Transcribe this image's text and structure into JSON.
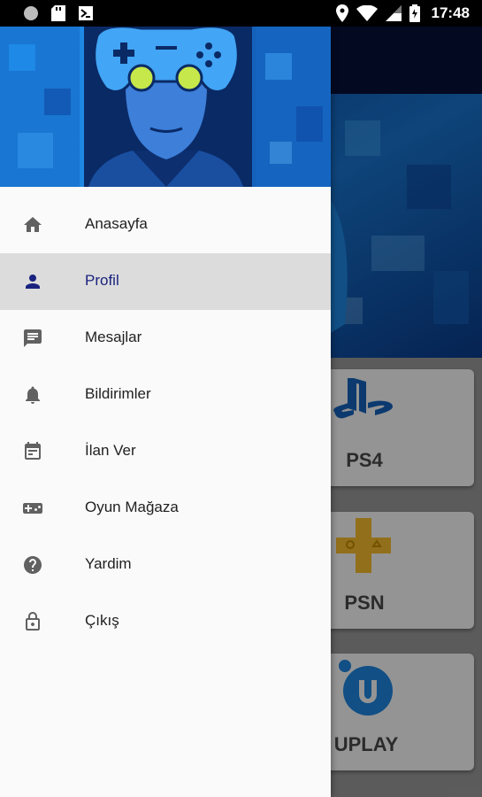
{
  "status_bar": {
    "time": "17:48",
    "icons": [
      "record-icon",
      "sd-card-icon",
      "app-notification-icon",
      "location-icon",
      "wifi-icon",
      "cell-signal-icon",
      "battery-icon"
    ]
  },
  "drawer": {
    "header_image": "gamer-controller-illustration",
    "items": [
      {
        "label": "Anasayfa",
        "icon": "home-icon",
        "active": false
      },
      {
        "label": "Profil",
        "icon": "person-icon",
        "active": true
      },
      {
        "label": "Mesajlar",
        "icon": "message-icon",
        "active": false
      },
      {
        "label": "Bildirimler",
        "icon": "bell-icon",
        "active": false
      },
      {
        "label": "İlan Ver",
        "icon": "calendar-icon",
        "active": false
      },
      {
        "label": "Oyun Mağaza",
        "icon": "gamepad-icon",
        "active": false
      },
      {
        "label": "Yardim",
        "icon": "help-icon",
        "active": false
      },
      {
        "label": "Çıkış",
        "icon": "lock-icon",
        "active": false
      }
    ]
  },
  "background_screen": {
    "cards": [
      {
        "label": "PS4",
        "icon": "playstation-logo-icon"
      },
      {
        "label": "PSN",
        "icon": "playstation-plus-logo-icon"
      },
      {
        "label": "UPLAY",
        "icon": "uplay-logo-icon"
      }
    ]
  },
  "colors": {
    "active_item_bg": "#dcdcdc",
    "active_item_text": "#1a237e",
    "icon_gray": "#616161",
    "header_blue": "#1565c0"
  }
}
